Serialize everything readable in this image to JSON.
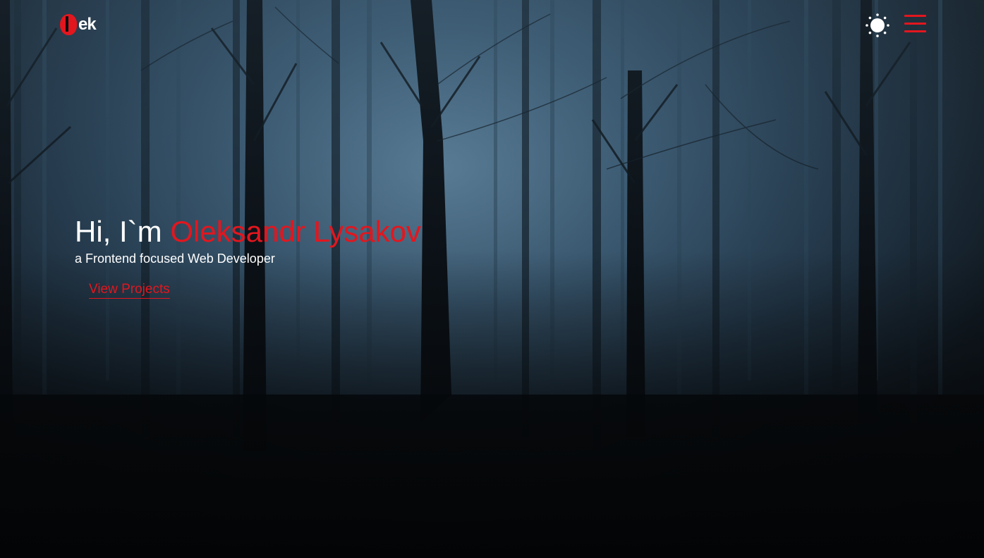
{
  "header": {
    "logo_text": "ek",
    "logo_mark_icon": "logo-mark-icon",
    "theme_toggle_icon": "sun-icon",
    "menu_icon": "hamburger-menu-icon"
  },
  "hero": {
    "greeting": "Hi, I`m",
    "name": "Oleksandr Lysakov",
    "tagline": "a Frontend focused Web Developer",
    "cta_label": "View Projects"
  },
  "colors": {
    "accent": "#e3161e",
    "text": "#ffffff",
    "background": "#0b0e12"
  }
}
